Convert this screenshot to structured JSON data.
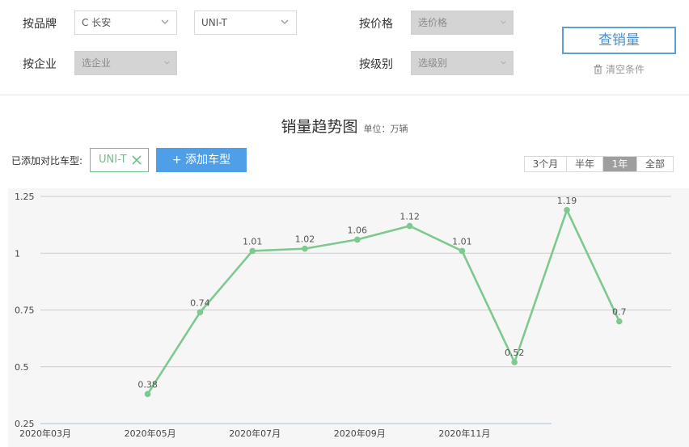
{
  "filters": {
    "brand_label": "按品牌",
    "brand_value": "C 长安",
    "model_value": "UNI-T",
    "company_label": "按企业",
    "company_placeholder": "选企业",
    "price_label": "按价格",
    "price_placeholder": "选价格",
    "level_label": "按级别",
    "level_placeholder": "选级别",
    "query_button": "查销量",
    "clear_label": "清空条件"
  },
  "header": {
    "title": "销量趋势图",
    "unit": "单位：万辆"
  },
  "compare": {
    "label": "已添加对比车型:",
    "tag": "UNI-T",
    "add_button": "+ 添加车型"
  },
  "ranges": [
    {
      "label": "3个月",
      "active": false
    },
    {
      "label": "半年",
      "active": false
    },
    {
      "label": "1年",
      "active": true
    },
    {
      "label": "全部",
      "active": false
    }
  ],
  "colors": {
    "series": "#7dc98f",
    "accent": "#4f9fe8",
    "tag": "#6cc08a"
  },
  "chart_data": {
    "type": "line",
    "x": [
      "2020年03月",
      "2020年04月",
      "2020年05月",
      "2020年06月",
      "2020年07月",
      "2020年08月",
      "2020年09月",
      "2020年10月",
      "2020年11月",
      "2020年12月",
      "2021年01月",
      "2021年02月"
    ],
    "x_ticks": [
      "2020年03月",
      "2020年05月",
      "2020年07月",
      "2020年09月",
      "2020年11月"
    ],
    "series": [
      {
        "values": [
          null,
          null,
          0.38,
          0.74,
          1.01,
          1.02,
          1.06,
          1.12,
          1.01,
          0.52,
          1.19,
          0.7
        ],
        "labels": [
          "",
          "",
          "0.38",
          "0.74",
          "1.01",
          "1.02",
          "1.06",
          "1.12",
          "1.01",
          "0.52",
          "1.19",
          "0.7"
        ]
      }
    ],
    "y_ticks": [
      "0.25",
      "0.5",
      "0.75",
      "1",
      "1.25"
    ],
    "ylim": [
      0.25,
      1.25
    ],
    "grid": true,
    "xlabel": "",
    "ylabel": ""
  }
}
